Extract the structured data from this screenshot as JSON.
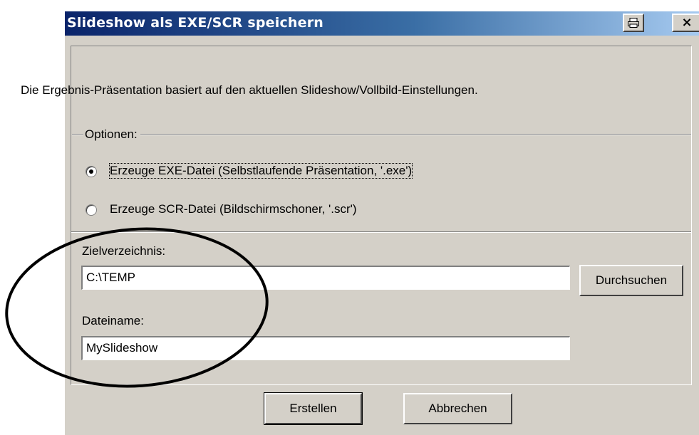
{
  "dialog": {
    "title": "Slideshow als EXE/SCR speichern",
    "title_buttons": {
      "print_icon": "print-icon",
      "close_glyph": "×"
    },
    "info_text": "Die Ergebnis-Präsentation basiert auf den aktuellen Slideshow/Vollbild-Einstellungen.",
    "options": {
      "label": "Optionen:",
      "exe_option": {
        "label": "Erzeuge EXE-Datei (Selbstlaufende Präsentation, '.exe')",
        "checked": true
      },
      "scr_option": {
        "label": "Erzeuge SCR-Datei (Bildschirmschoner, '.scr')",
        "checked": false
      }
    },
    "target_dir": {
      "label": "Zielverzeichnis:",
      "value": "C:\\TEMP",
      "browse_label": "Durchsuchen"
    },
    "filename": {
      "label": "Dateiname:",
      "value": "MySlideshow"
    },
    "buttons": {
      "create_label": "Erstellen",
      "cancel_label": "Abbrechen"
    }
  },
  "colors": {
    "title_gradient_start": "#0a246a",
    "title_gradient_end": "#a6caf0",
    "dialog_face": "#d4d0c8"
  }
}
